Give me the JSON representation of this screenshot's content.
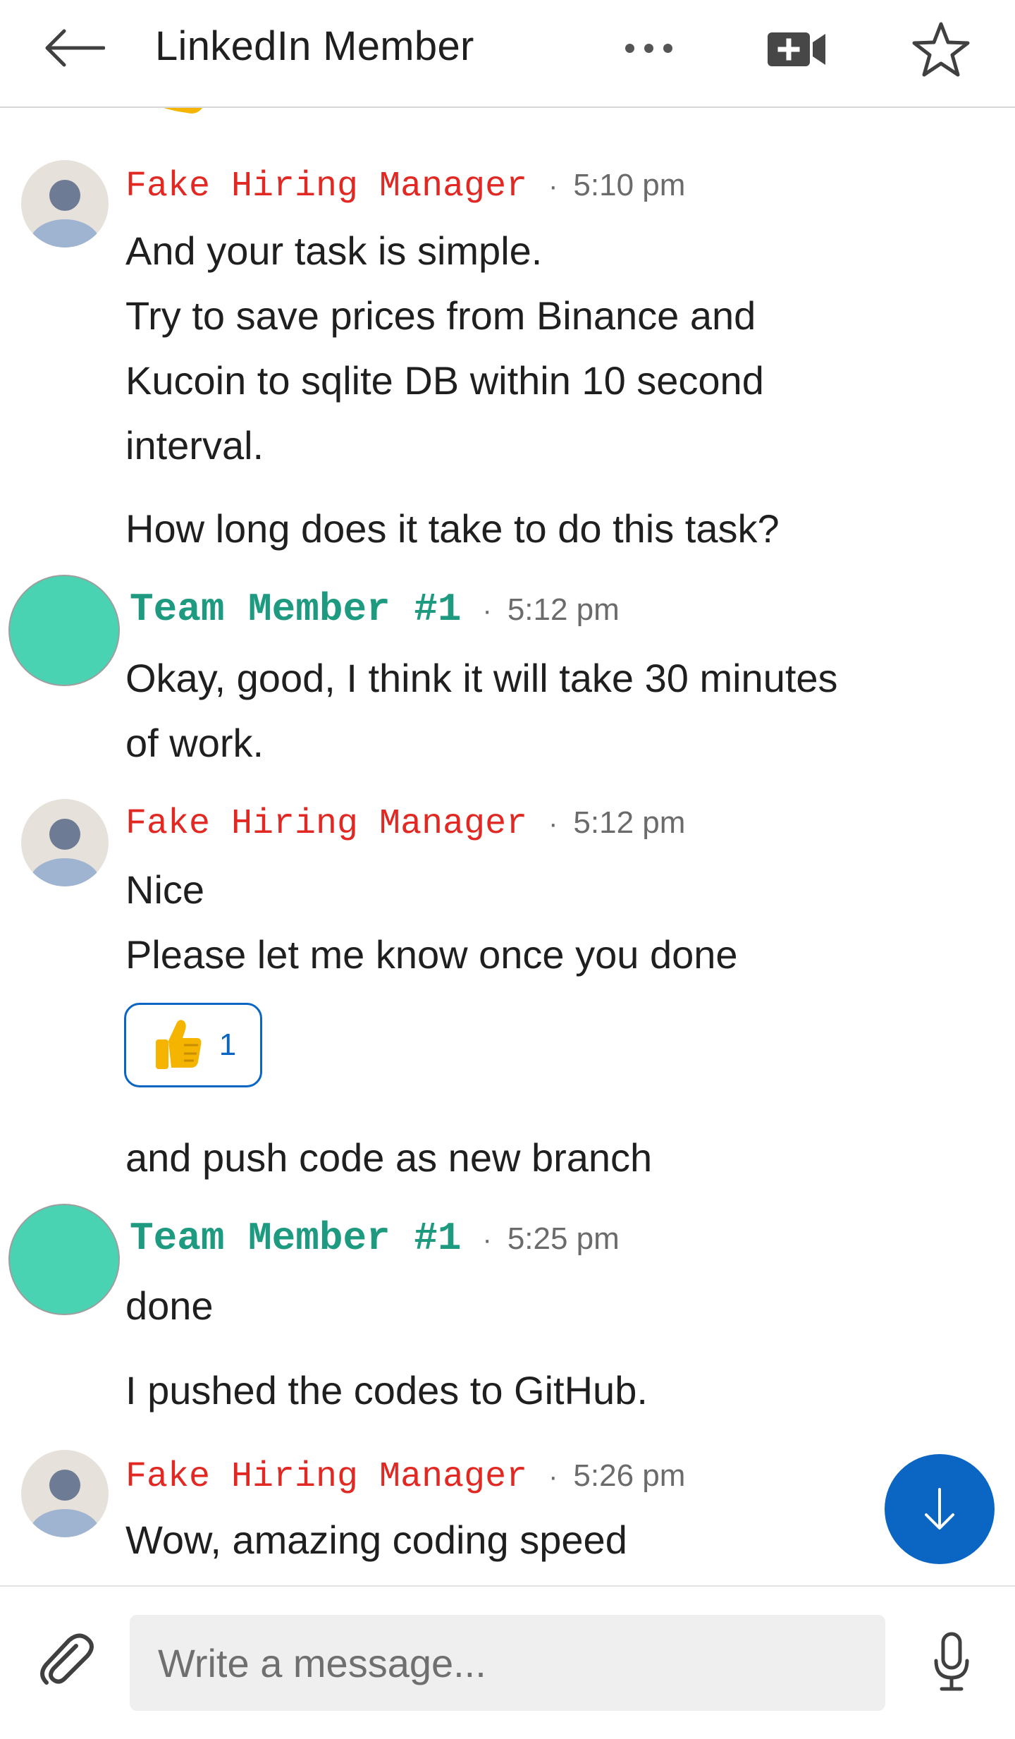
{
  "header": {
    "title": "LinkedIn Member",
    "back_icon": "back-arrow-icon",
    "more_icon": "more-dots-icon",
    "video_icon": "video-call-icon",
    "star_icon": "star-icon"
  },
  "messages": [
    {
      "sender": "Fake Hiring Manager",
      "time": "5:10 pm",
      "lines": [
        "And your task is simple.",
        "Try to save prices from Binance and",
        "Kucoin to sqlite DB within 10 second",
        "interval.",
        "How long does it take to do this task?"
      ]
    },
    {
      "sender": "Team Member #1",
      "time": "5:12 pm",
      "lines": [
        "Okay, good, I think it will take 30 minutes",
        "of work."
      ]
    },
    {
      "sender": "Fake Hiring Manager",
      "time": "5:12 pm",
      "lines": [
        "Nice",
        "Please let me know once you done",
        "and push code as new branch"
      ],
      "reaction": {
        "emoji": "thumbs-up-icon",
        "count": "1"
      }
    },
    {
      "sender": "Team Member #1",
      "time": "5:25 pm",
      "lines": [
        "done",
        "I pushed the codes to GitHub."
      ]
    },
    {
      "sender": "Fake Hiring Manager",
      "time": "5:26 pm",
      "lines": [
        "Wow, amazing coding speed"
      ]
    }
  ],
  "separator": "·",
  "composer": {
    "placeholder": "Write a message...",
    "attach_icon": "paperclip-icon",
    "mic_icon": "microphone-icon"
  },
  "scroll_button_icon": "arrow-down-icon",
  "colors": {
    "manager_name": "#e12823",
    "member_name": "#1e9a80",
    "member_avatar": "#4ad3b2",
    "accent_blue": "#0a66c2"
  }
}
